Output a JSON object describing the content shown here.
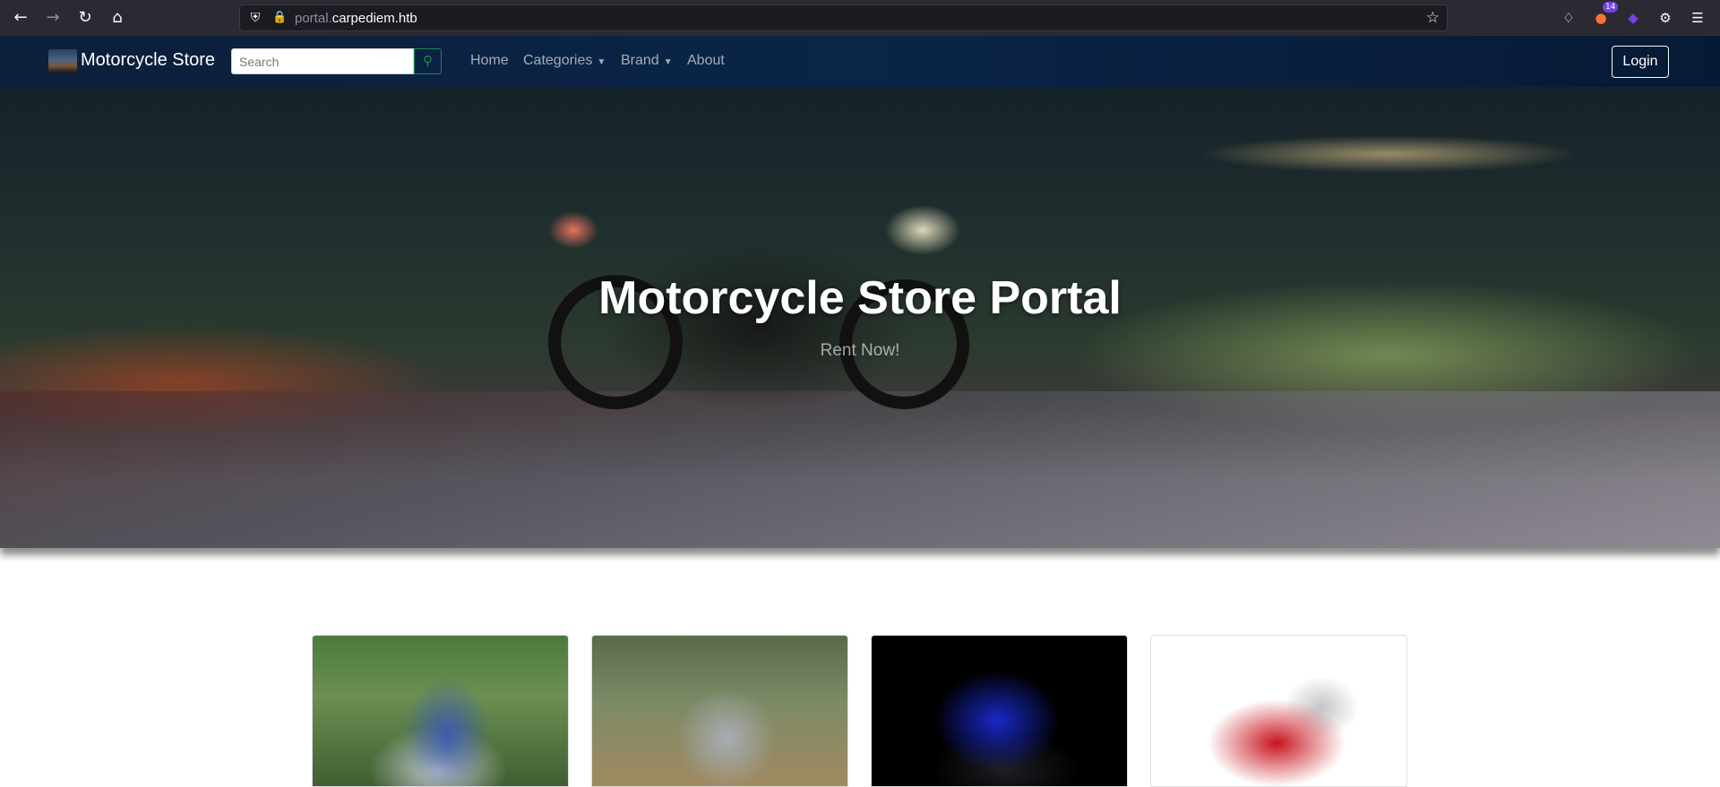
{
  "browser": {
    "url_subdomain": "portal.",
    "url_domain": "carpediem.htb",
    "extension_badge": "14",
    "icons": [
      "back-icon",
      "forward-icon",
      "reload-icon",
      "home-icon",
      "shield-icon",
      "lock-icon",
      "star-icon",
      "pocket-icon",
      "extension-icon",
      "extension-icon",
      "settings-icon",
      "menu-icon"
    ]
  },
  "navbar": {
    "brand": "Motorcycle Store",
    "search_placeholder": "Search",
    "links": {
      "home": "Home",
      "categories": "Categories",
      "brand": "Brand",
      "about": "About"
    },
    "login": "Login"
  },
  "hero": {
    "title": "Motorcycle Store Portal",
    "subtitle": "Rent Now!"
  },
  "products": [
    {
      "image": "blue-white-adventure-motorcycle"
    },
    {
      "image": "grey-adventure-motorcycle"
    },
    {
      "image": "blue-sport-motorcycle"
    },
    {
      "image": "red-sport-motorcycle"
    }
  ],
  "colors": {
    "navbar_bg": "#0a2548",
    "search_button": "#198754",
    "chrome_bg": "#2b2a33"
  }
}
